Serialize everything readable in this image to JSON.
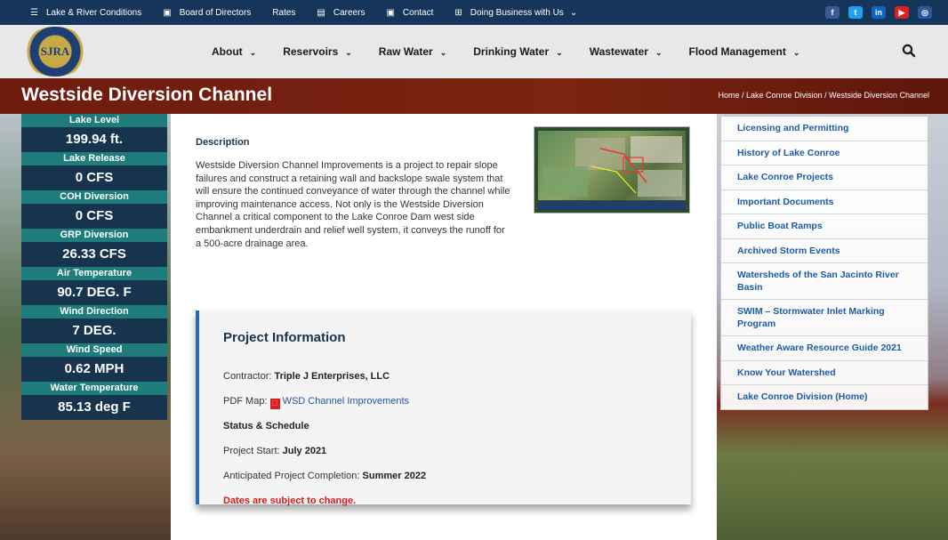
{
  "topbar": {
    "links": [
      {
        "label": "Lake & River Conditions",
        "icon": "menu-icon"
      },
      {
        "label": "Board of Directors",
        "icon": "id-card-icon"
      },
      {
        "label": "Rates",
        "icon": ""
      },
      {
        "label": "Careers",
        "icon": "building-icon"
      },
      {
        "label": "Contact",
        "icon": "contact-card-icon"
      },
      {
        "label": "Doing Business with Us",
        "icon": "network-icon"
      }
    ],
    "social": [
      {
        "name": "facebook-icon",
        "glyph": "f",
        "color": "#3b5998"
      },
      {
        "name": "twitter-icon",
        "glyph": "t",
        "color": "#1da1f2"
      },
      {
        "name": "linkedin-icon",
        "glyph": "in",
        "color": "#0a66c2"
      },
      {
        "name": "youtube-icon",
        "glyph": "▶",
        "color": "#e02020"
      },
      {
        "name": "instagram-icon",
        "glyph": "◎",
        "color": "#2a5a9e"
      }
    ]
  },
  "header": {
    "logo_text": "SJRA",
    "nav": [
      "About",
      "Reservoirs",
      "Raw Water",
      "Drinking Water",
      "Wastewater",
      "Flood Management"
    ]
  },
  "title": {
    "heading": "Westside Diversion Channel",
    "breadcrumb": [
      "Home",
      "Lake Conroe Division",
      "Westside Diversion Channel"
    ]
  },
  "lake": [
    {
      "label": "Lake Level",
      "value": "199.94 ft."
    },
    {
      "label": "Lake Release",
      "value": "0 CFS"
    },
    {
      "label": "COH Diversion",
      "value": "0 CFS"
    },
    {
      "label": "GRP Diversion",
      "value": "26.33 CFS"
    },
    {
      "label": "Air Temperature",
      "value": "90.7 DEG. F"
    },
    {
      "label": "Wind Direction",
      "value": "7 DEG."
    },
    {
      "label": "Wind Speed",
      "value": "0.62 MPH"
    },
    {
      "label": "Water Temperature",
      "value": "85.13 deg F"
    }
  ],
  "main": {
    "description_heading": "Description",
    "description": "Westside Diversion Channel Improvements is a project to repair slope failures and construct a retaining wall and backslope swale system that will ensure the continued conveyance of water through the channel while improving maintenance access.   Not only is the Westside Diversion Channel a critical component to the Lake Conroe Dam west side embankment underdrain and relief well system, it conveys the runoff for a 500-acre drainage area.",
    "project": {
      "heading": "Project Information",
      "contractor_label": "Contractor: ",
      "contractor": "Triple J Enterprises, LLC",
      "pdf_label": "PDF Map: ",
      "pdf_link": "WSD Channel Improvements",
      "status_heading": "Status & Schedule",
      "start_label": "Project Start: ",
      "start": "July 2021",
      "completion_label": "Anticipated Project Completion: ",
      "completion": "Summer 2022",
      "note": "Dates are subject to change."
    }
  },
  "sidebar": [
    "Licensing and Permitting",
    "History of Lake Conroe",
    "Lake Conroe Projects",
    "Important Documents",
    "Public Boat Ramps",
    "Archived Storm Events",
    "Watersheds of the San Jacinto River Basin",
    "SWIM – Stormwater Inlet Marking Program",
    "Weather Aware Resource Guide 2021",
    "Know Your Watershed",
    "Lake Conroe Division (Home)"
  ]
}
